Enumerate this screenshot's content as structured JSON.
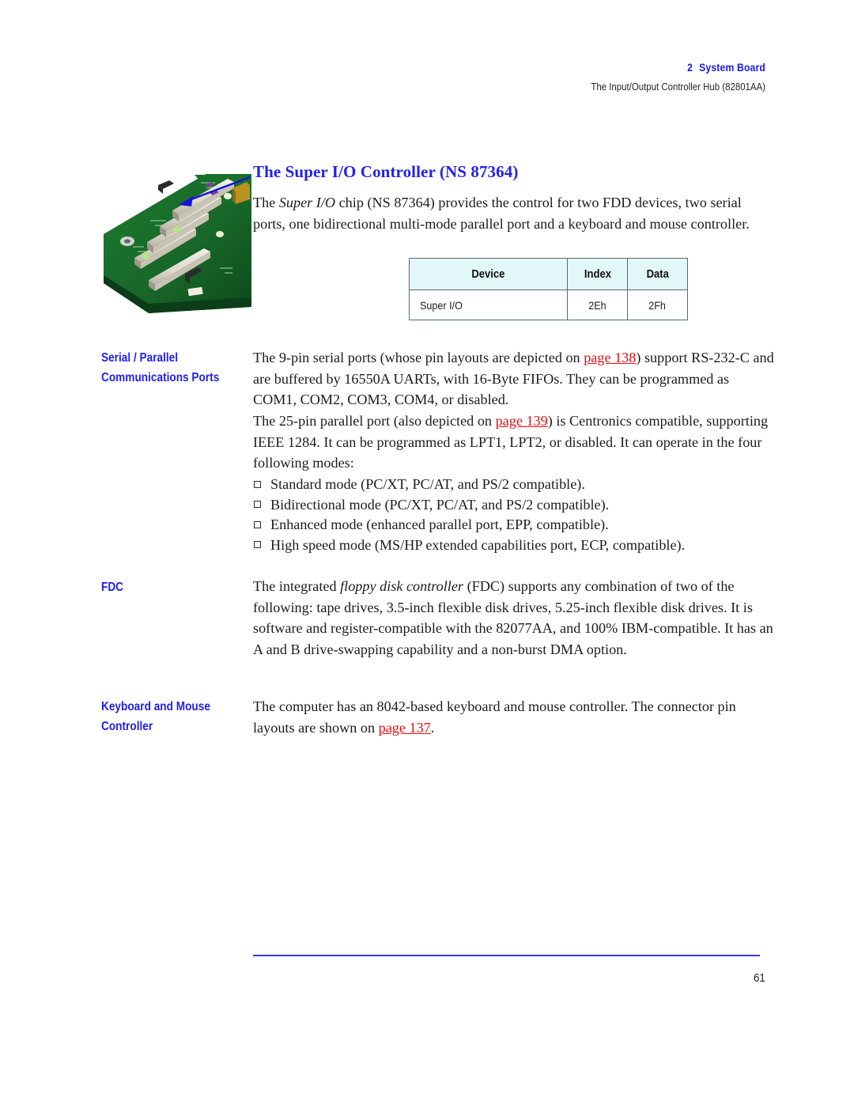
{
  "running_head": {
    "chapter_number": "2",
    "chapter_title": "System Board",
    "subtitle": "The Input/Output Controller Hub (82801AA)"
  },
  "figure": {
    "alt": "system-board-photo-pci-slots-with-blue-arrow-pointing-to-super-io-chip"
  },
  "section": {
    "title": "The Super I/O Controller (NS 87364)",
    "intro": {
      "part1": "The ",
      "italic": "Super I/O",
      "part2": " chip (NS 87364) provides the control for two FDD devices, two serial ports, one bidirectional multi-mode parallel port and a keyboard and mouse controller."
    }
  },
  "register_table": {
    "headers": [
      "Device",
      "Index",
      "Data"
    ],
    "rows": [
      {
        "device": "Super I/O",
        "index": "2Eh",
        "data": "2Fh"
      }
    ]
  },
  "serial_parallel": {
    "heading_line1": "Serial / Parallel",
    "heading_line2": "Communications Ports",
    "para1": {
      "part1": "The 9-pin serial ports (whose pin layouts are depicted on ",
      "link": "page 138",
      "part2": ") support RS-232-C and are buffered by 16550A UARTs, with 16-Byte FIFOs. They can be programmed as COM1, COM2, COM3, COM4, or disabled."
    },
    "para2": {
      "part1": "The 25-pin parallel port (also depicted on ",
      "link": "page 139",
      "part2": ") is Centronics compatible, supporting IEEE 1284. It can be programmed as LPT1, LPT2, or disabled. It can operate in the four following modes:"
    },
    "modes": [
      "Standard mode (PC/XT, PC/AT, and PS/2 compatible).",
      "Bidirectional mode (PC/XT, PC/AT, and PS/2 compatible).",
      "Enhanced mode (enhanced parallel port, EPP, compatible).",
      "High speed mode (MS/HP extended capabilities port, ECP, compatible)."
    ]
  },
  "fdc": {
    "heading_line1": "FDC",
    "para": {
      "part1": "The integrated ",
      "italic": "floppy disk controller",
      "part2": " (FDC) supports any combination of two of the following: tape drives, 3.5-inch flexible disk drives, 5.25-inch flexible disk drives. It is software and register-compatible with the 82077AA, and 100% IBM-compatible. It has an A and B drive-swapping capability and a non-burst DMA option."
    }
  },
  "keyboard_mouse": {
    "heading_line1": "Keyboard and Mouse",
    "heading_line2": "Controller",
    "para": {
      "part1": "The computer has an 8042-based keyboard and mouse controller. The connector pin layouts are shown on ",
      "link": "page 137",
      "part2": "."
    }
  },
  "footer": {
    "page_number": "61"
  },
  "colors": {
    "heading_blue": "#2222e8",
    "link_red": "#e01010",
    "table_header_bg": "#e2f8f8",
    "rule_blue": "#3a3ae0"
  }
}
